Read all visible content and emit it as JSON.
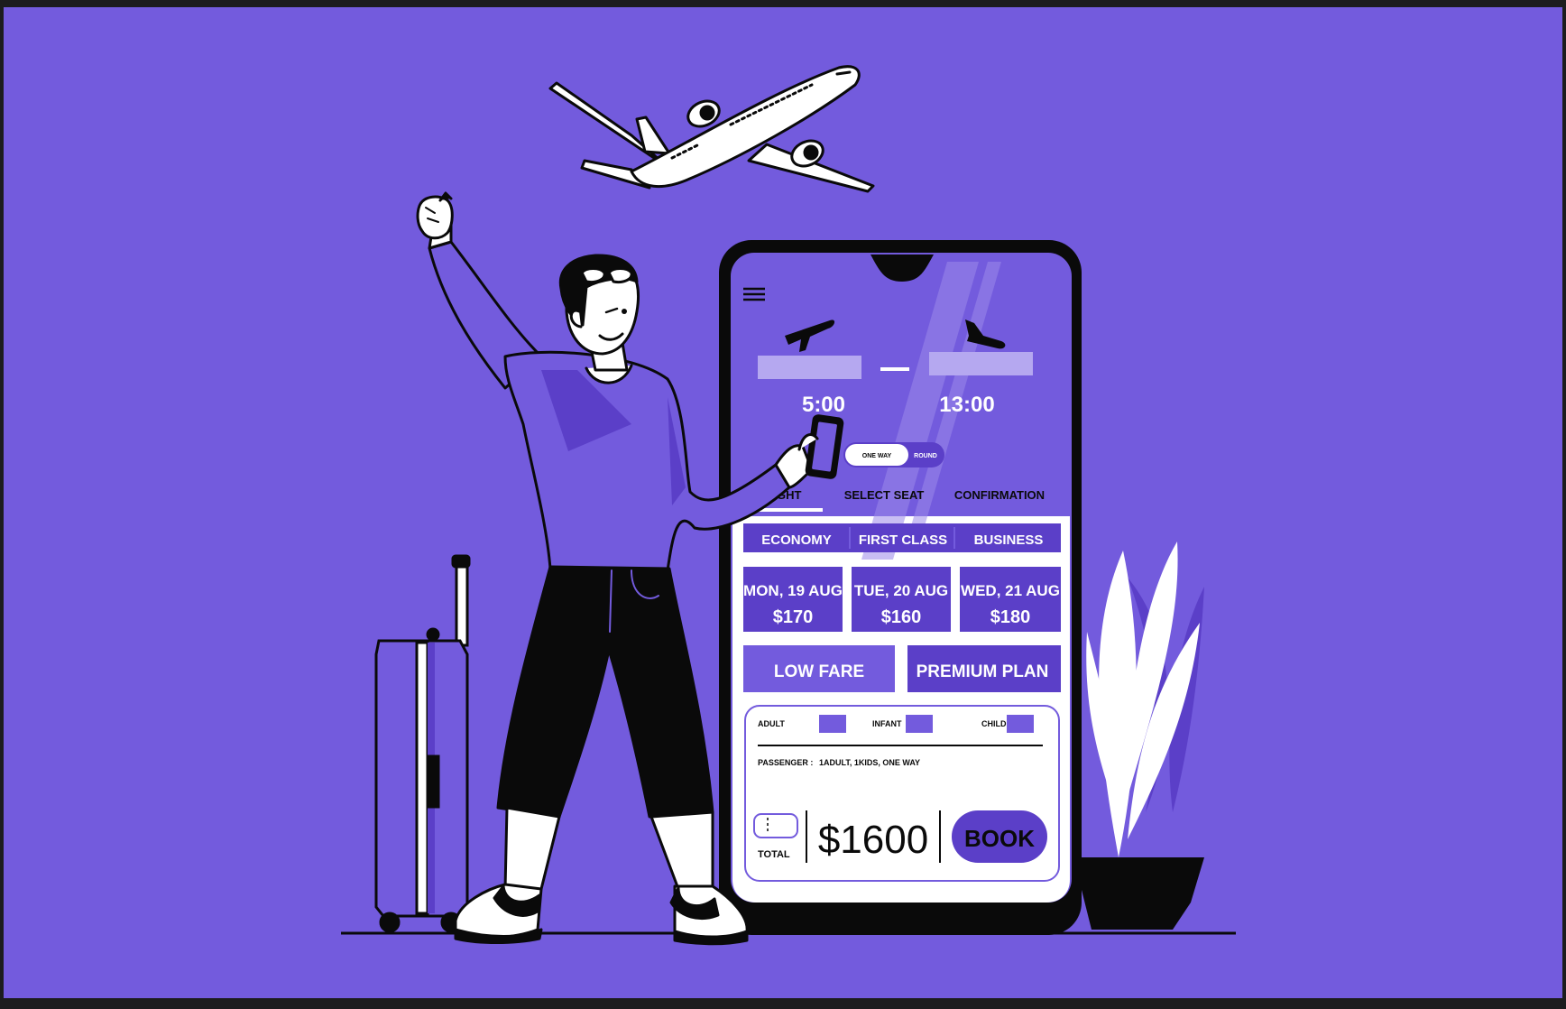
{
  "colors": {
    "background": "#735BDD",
    "frame": "#1c1c1e",
    "accent": "#5B3FC8",
    "light_tint": "#B5A8F0",
    "white": "#FFFFFF",
    "ink": "#0A0A0A"
  },
  "app": {
    "menu_icon": "hamburger-icon",
    "departure": {
      "icon": "plane-takeoff-icon",
      "time": "5:00"
    },
    "arrival": {
      "icon": "plane-landing-icon",
      "time": "13:00"
    },
    "trip_toggle": {
      "options": [
        "ONE WAY",
        "ROUND"
      ],
      "selected": "ONE WAY"
    },
    "steps": [
      "FLIGHT",
      "SELECT SEAT",
      "CONFIRMATION"
    ],
    "classes": [
      "ECONOMY",
      "FIRST CLASS",
      "BUSINESS"
    ],
    "dates": [
      {
        "day": "MON, 19 AUG",
        "price": "$170"
      },
      {
        "day": "TUE, 20 AUG",
        "price": "$160"
      },
      {
        "day": "WED, 21 AUG",
        "price": "$180"
      }
    ],
    "fares": [
      "LOW FARE",
      "PREMIUM PLAN"
    ],
    "passenger_types": [
      "ADULT",
      "INFANT",
      "CHILD"
    ],
    "passenger_label": "PASSENGER :",
    "passenger_value": "1ADULT, 1KIDS, ONE WAY",
    "total_label": "TOTAL",
    "total_price": "$1600",
    "book_label": "BOOK"
  }
}
